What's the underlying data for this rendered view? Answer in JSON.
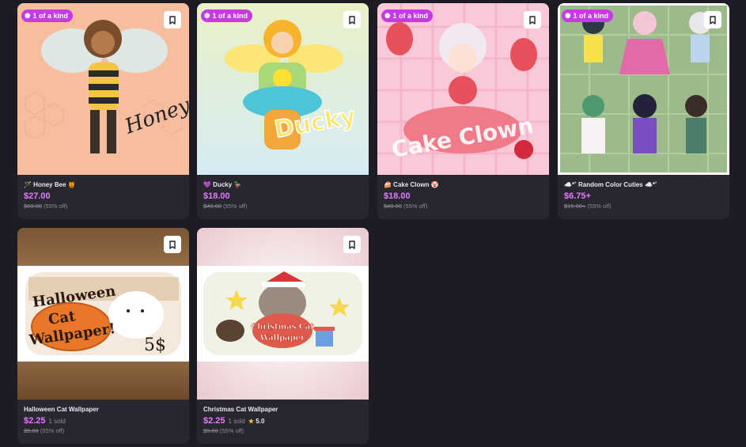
{
  "badge_label": "1 of a kind",
  "colors": {
    "accent": "#c63ae3",
    "price": "#e27bff",
    "background": "#1d1c25",
    "card": "#28272f"
  },
  "products": [
    {
      "title": "🪄 Honey Bee 🍯",
      "price": "$27.00",
      "original_price": "$60.00",
      "discount": "(55% off)",
      "badge": true
    },
    {
      "title": "💜 Ducky 🦆",
      "price": "$18.00",
      "original_price": "$40.00",
      "discount": "(55% off)",
      "badge": true
    },
    {
      "title": "🍰 Cake Clown 🤡",
      "price": "$18.00",
      "original_price": "$40.00",
      "discount": "(55% off)",
      "badge": true
    },
    {
      "title": "☁️*˚ Random Color Cuties ☁️*˚",
      "price": "$6.75+",
      "original_price": "$15.00+",
      "discount": "(55% off)",
      "badge": true
    },
    {
      "title": "Halloween Cat Wallpaper",
      "price": "$2.25",
      "sold": "1 sold",
      "original_price": "$5.00",
      "discount": "(55% off)",
      "badge": false
    },
    {
      "title": "Christmas Cat Wallpaper",
      "price": "$2.25",
      "sold": "1 sold",
      "rating": "5.0",
      "original_price": "$5.00",
      "discount": "(55% off)",
      "badge": false
    }
  ],
  "art_text": {
    "honey_bee": "Honey Bee",
    "ducky": "Ducky",
    "cake_clown": "Cake Clown",
    "halloween_line1": "Halloween",
    "halloween_line2": "Cat",
    "halloween_line3": "Wallpaper!",
    "halloween_price": "5$",
    "christmas_line1": "Christmas Cat",
    "christmas_line2": "Wallpaper"
  },
  "icons": {
    "bookmark": "bookmark-icon",
    "badge": "sparkle-icon",
    "rating": "star-icon"
  }
}
